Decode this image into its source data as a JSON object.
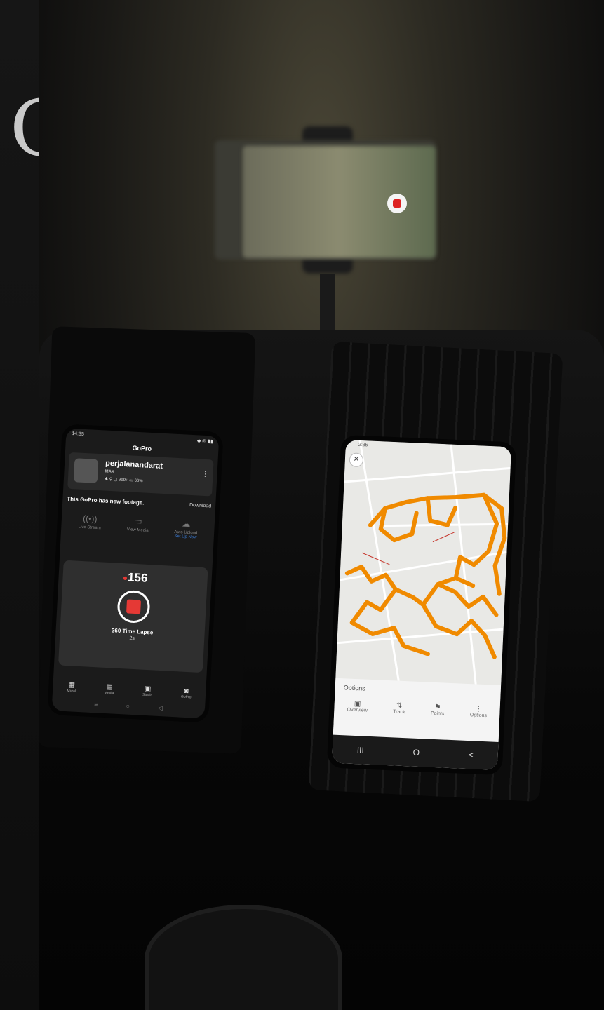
{
  "side_glyph": "C",
  "mount_phone": {
    "record_icon": "record-stop-icon"
  },
  "gopro_phone": {
    "status_time": "14:35",
    "status_right": "◆ ◎ ▮▮",
    "title": "GoPro",
    "camera": {
      "name": "perjalanandarat",
      "model": "MAX",
      "stats": "✱ ⚲ ▢ 999+ ▭ 66%"
    },
    "notice": {
      "text": "This GoPro has new footage.",
      "action": "Download"
    },
    "quick_actions": [
      {
        "icon": "live-stream-icon",
        "label": "Live Stream"
      },
      {
        "icon": "view-media-icon",
        "label": "View Media"
      },
      {
        "icon": "auto-upload-icon",
        "label": "Auto Upload",
        "link": "Set Up Now"
      }
    ],
    "recording": {
      "count": "156",
      "mode": "360 Time Lapse",
      "interval": "2s"
    },
    "nav": [
      {
        "icon": "grid-icon",
        "label": "Mural"
      },
      {
        "icon": "media-icon",
        "label": "Media"
      },
      {
        "icon": "studio-icon",
        "label": "Studio"
      },
      {
        "icon": "gopro-icon",
        "label": "GoPro"
      }
    ],
    "system_nav": [
      "≡",
      "○",
      "◁"
    ]
  },
  "map_phone": {
    "status_time": "2:35",
    "sheet_title": "Options",
    "tabs": [
      {
        "icon": "overview-icon",
        "label": "Overview"
      },
      {
        "icon": "track-icon",
        "label": "Track"
      },
      {
        "icon": "flag-icon",
        "label": "Points"
      },
      {
        "icon": "more-icon",
        "label": "Options"
      }
    ],
    "system_nav": [
      "III",
      "O",
      "<"
    ],
    "colors": {
      "track": "#f08a00",
      "map_bg": "#e9e9e6",
      "road": "#ffffff"
    }
  }
}
